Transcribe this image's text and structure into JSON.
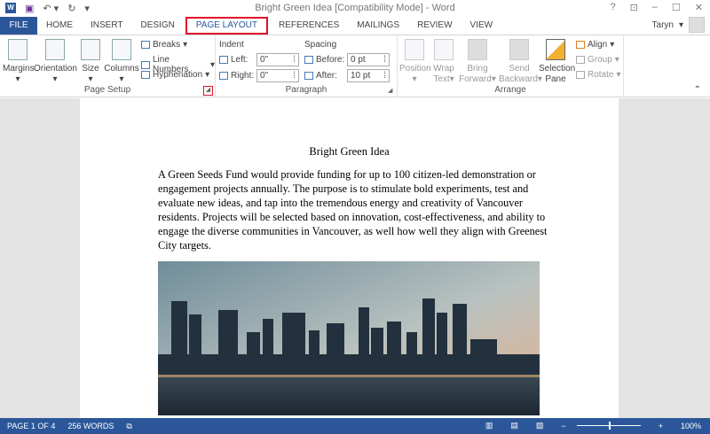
{
  "window": {
    "title": "Bright Green Idea [Compatibility Mode] - Word",
    "help": "?",
    "user": "Taryn"
  },
  "tabs": [
    "FILE",
    "HOME",
    "INSERT",
    "DESIGN",
    "PAGE LAYOUT",
    "REFERENCES",
    "MAILINGS",
    "REVIEW",
    "VIEW"
  ],
  "page_setup": {
    "margins": "Margins",
    "orientation": "Orientation",
    "size": "Size",
    "columns": "Columns",
    "breaks": "Breaks",
    "line_numbers": "Line Numbers",
    "hyphenation": "Hyphenation",
    "label": "Page Setup"
  },
  "paragraph": {
    "indent": "Indent",
    "left_label": "Left:",
    "left_value": "0\"",
    "right_label": "Right:",
    "right_value": "0\"",
    "spacing": "Spacing",
    "before_label": "Before:",
    "before_value": "0 pt",
    "after_label": "After:",
    "after_value": "10 pt",
    "label": "Paragraph"
  },
  "arrange": {
    "position": "Position",
    "wrap1": "Wrap",
    "wrap2": "Text",
    "bring1": "Bring",
    "bring2": "Forward",
    "send1": "Send",
    "send2": "Backward",
    "sel1": "Selection",
    "sel2": "Pane",
    "align": "Align",
    "group": "Group",
    "rotate": "Rotate",
    "label": "Arrange"
  },
  "document": {
    "title": "Bright Green Idea",
    "body": "A Green Seeds Fund would provide funding for up to 100 citizen-led demonstration or engagement projects annually. The purpose is to stimulate bold experiments, test and evaluate new ideas, and tap into the tremendous energy and creativity of Vancouver residents. Projects will be selected based on innovation, cost-effectiveness, and ability to engage the diverse communities in Vancouver, as well how well they align with Greenest City targets."
  },
  "status": {
    "page": "PAGE 1 OF 4",
    "words": "256 WORDS",
    "zoom": "100%"
  }
}
